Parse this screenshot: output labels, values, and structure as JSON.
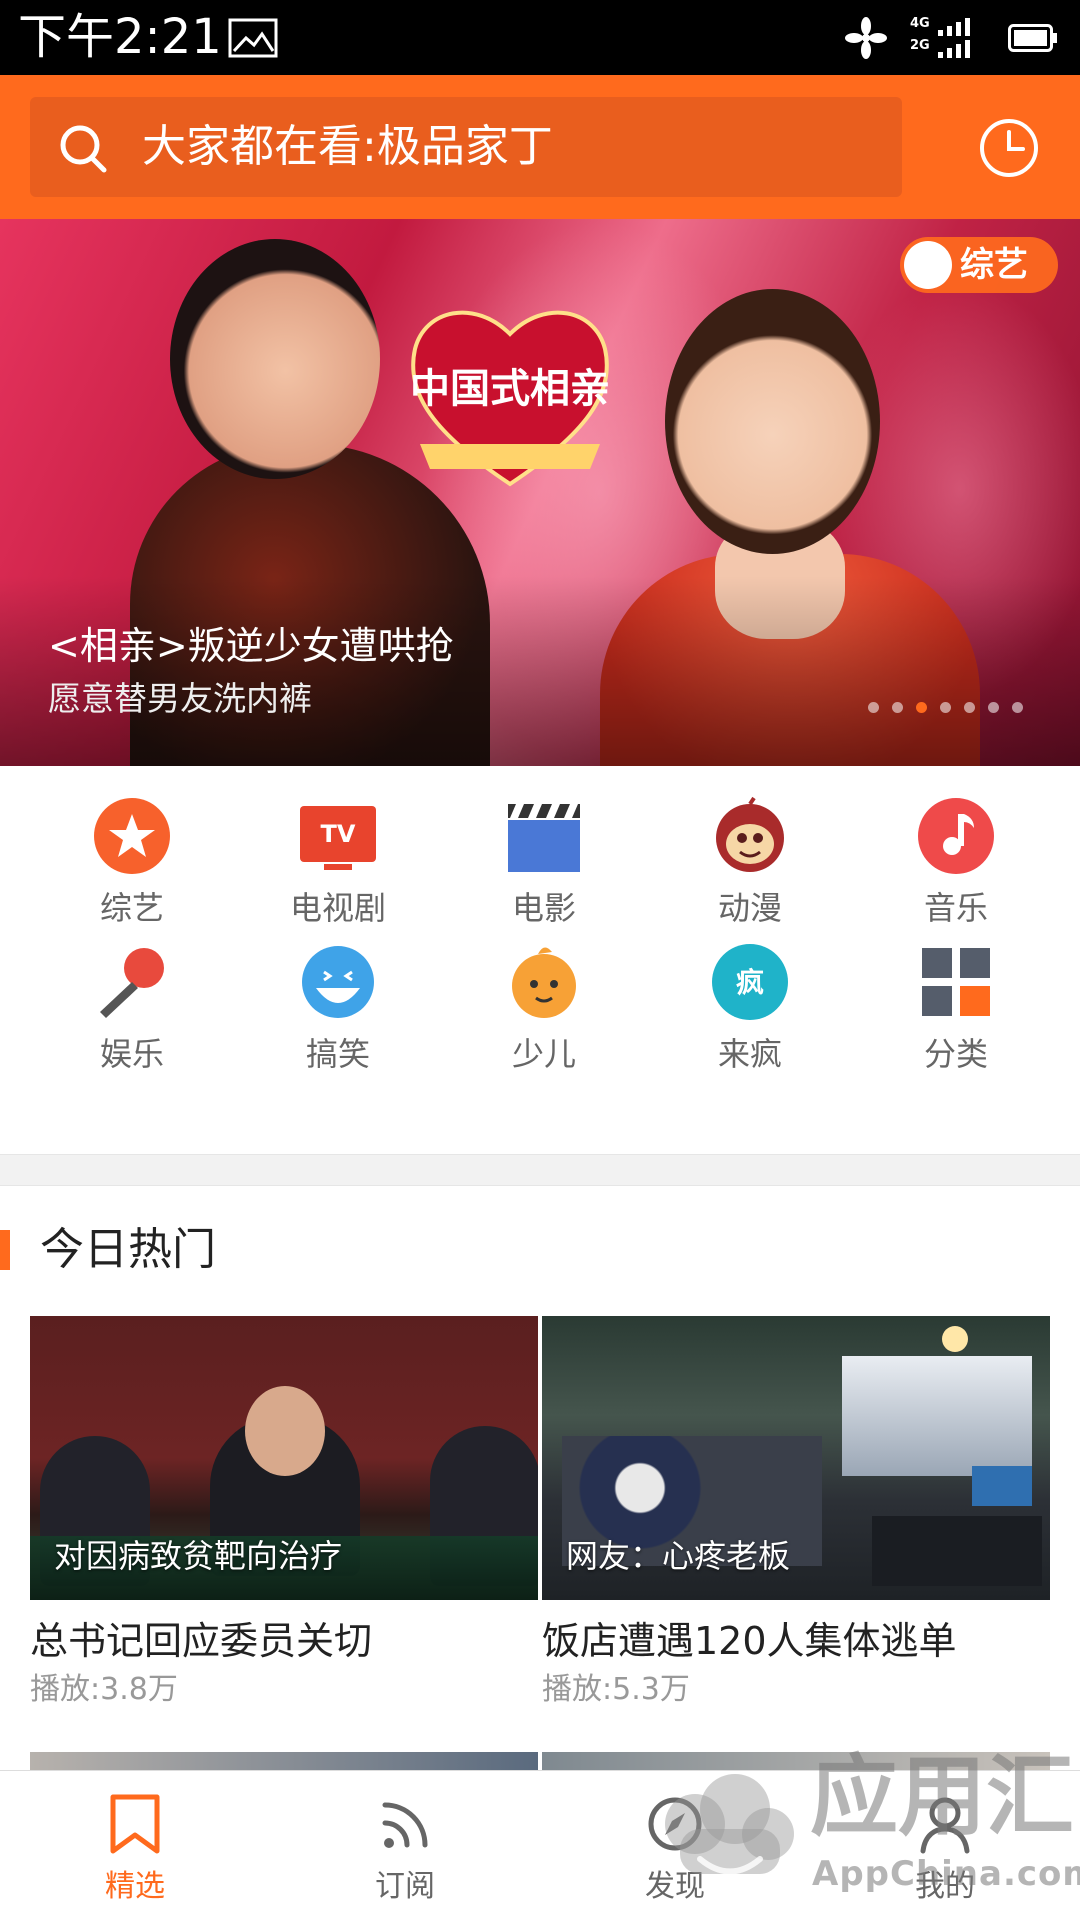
{
  "status_bar": {
    "time": "下午2:21",
    "network_top": "4G",
    "network_bottom": "2G"
  },
  "search": {
    "placeholder": "大家都在看:极品家丁"
  },
  "banner": {
    "category_tag": "综艺",
    "show_logo_text": "中国式相亲",
    "title": "<相亲>叛逆少女遭哄抢",
    "subtitle": "愿意替男友洗内裤",
    "dots_total": 7,
    "dot_active_index": 2
  },
  "categories": [
    {
      "label": "综艺",
      "icon": "star-icon",
      "color": "#f7612c"
    },
    {
      "label": "电视剧",
      "icon": "tv-icon",
      "color": "#e8442d"
    },
    {
      "label": "电影",
      "icon": "clapperboard-icon",
      "color": "#4a78d6"
    },
    {
      "label": "动漫",
      "icon": "monkey-icon",
      "color": "#a92b2b"
    },
    {
      "label": "音乐",
      "icon": "music-note-icon",
      "color": "#ef4a4a"
    },
    {
      "label": "娱乐",
      "icon": "microphone-icon",
      "color": "#e84a3d"
    },
    {
      "label": "搞笑",
      "icon": "laughing-face-icon",
      "color": "#3fa3e8"
    },
    {
      "label": "少儿",
      "icon": "baby-face-icon",
      "color": "#f7a136"
    },
    {
      "label": "来疯",
      "icon": "laifeng-icon",
      "color": "#1fb3c9"
    },
    {
      "label": "分类",
      "icon": "grid-icon",
      "color": "#555d6b"
    }
  ],
  "hot_section": {
    "title": "今日热门",
    "videos": [
      {
        "overlay": "对因病致贫靶向治疗",
        "title": "总书记回应委员关切",
        "plays": "播放:3.8万"
      },
      {
        "overlay": "网友：心疼老板",
        "title": "饭店遭遇120人集体逃单",
        "plays": "播放:5.3万"
      }
    ]
  },
  "bottom_nav": {
    "items": [
      {
        "label": "精选",
        "icon": "bookmark-icon",
        "active": true
      },
      {
        "label": "订阅",
        "icon": "rss-icon",
        "active": false
      },
      {
        "label": "发现",
        "icon": "compass-icon",
        "active": false
      },
      {
        "label": "我的",
        "icon": "person-icon",
        "active": false
      }
    ]
  },
  "watermark": {
    "main": "应用汇",
    "sub": "AppChina.com"
  },
  "colors": {
    "accent": "#ff6a1d",
    "search_box": "#e95e1e",
    "inactive_text": "#666666"
  }
}
